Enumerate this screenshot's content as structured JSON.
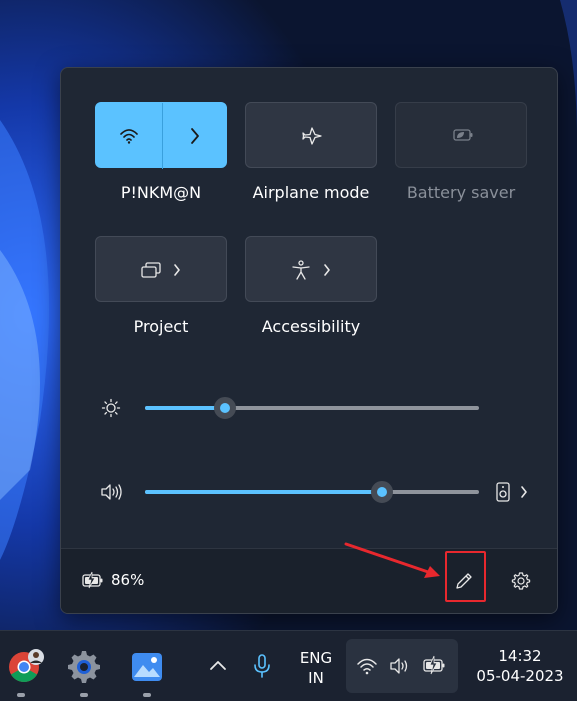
{
  "quick_settings": {
    "wifi": {
      "label": "P!NKM@N",
      "icon": "wifi-icon",
      "state": "on"
    },
    "airplane": {
      "label": "Airplane mode",
      "icon": "airplane-icon"
    },
    "battery_saver": {
      "label": "Battery saver",
      "icon": "battery-saver-icon",
      "state": "disabled"
    },
    "project": {
      "label": "Project",
      "icon": "project-icon"
    },
    "accessibility": {
      "label": "Accessibility",
      "icon": "accessibility-icon"
    }
  },
  "sliders": {
    "brightness": {
      "icon": "brightness-icon",
      "percent": 24
    },
    "volume": {
      "icon": "speaker-icon",
      "percent": 71,
      "output_icon": "speaker-device-icon"
    }
  },
  "footer": {
    "battery_percent": "86%",
    "edit_icon": "pencil-icon",
    "settings_icon": "gear-icon"
  },
  "taskbar": {
    "apps": [
      "chrome-icon",
      "settings-app-icon",
      "photos-icon"
    ],
    "language_line1": "ENG",
    "language_line2": "IN",
    "time": "14:32",
    "date": "05-04-2023"
  },
  "colors": {
    "accent": "#5bc2ff",
    "annotation": "#e8282e"
  }
}
